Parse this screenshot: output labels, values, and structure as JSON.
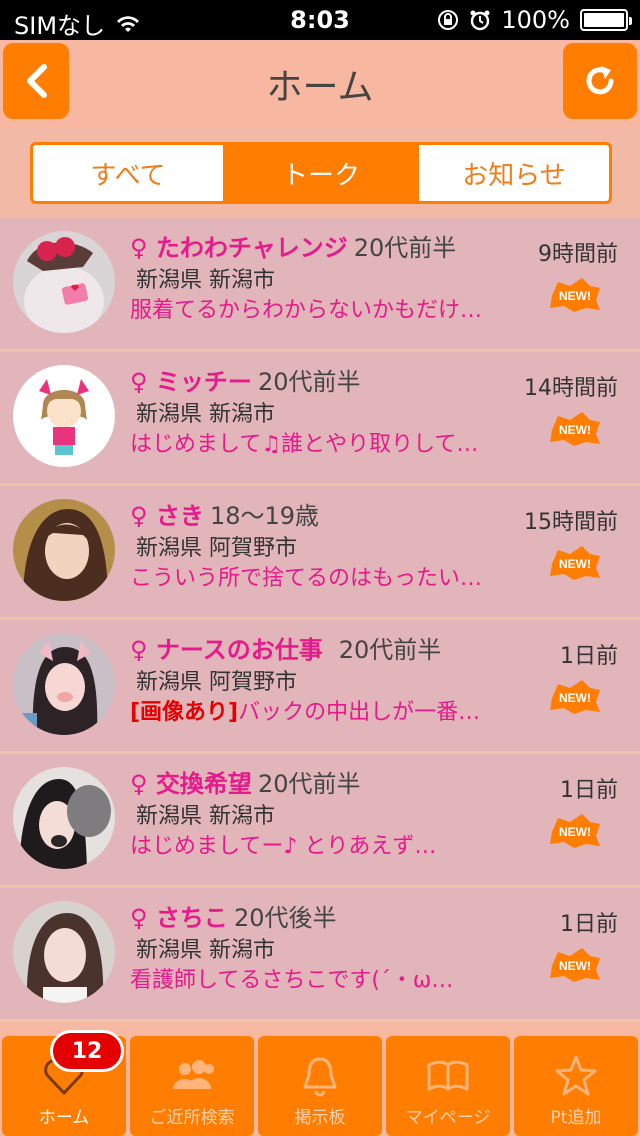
{
  "status_bar": {
    "carrier": "SIMなし",
    "time": "8:03",
    "battery": "100%"
  },
  "header": {
    "title": "ホーム"
  },
  "segments": [
    {
      "label": "すべて",
      "active": false
    },
    {
      "label": "トーク",
      "active": true
    },
    {
      "label": "お知らせ",
      "active": false
    }
  ],
  "items": [
    {
      "name": "♀ たわわチャレンジ",
      "age": "20代前半",
      "location": "新潟県 新潟市",
      "message": "服着てるからわからないかもだけ…",
      "tag": "",
      "time": "9時間前",
      "new": true
    },
    {
      "name": "♀ ミッチー",
      "age": "20代前半",
      "location": "新潟県 新潟市",
      "message": "はじめまして♫誰とやり取りして…",
      "tag": "",
      "time": "14時間前",
      "new": true
    },
    {
      "name": "♀ さき",
      "age": "18〜19歳",
      "location": "新潟県 阿賀野市",
      "message": "こういう所で捨てるのはもったい…",
      "tag": "",
      "time": "15時間前",
      "new": true
    },
    {
      "name": "♀ ナースのお仕事",
      "age": "20代前半",
      "location": "新潟県 阿賀野市",
      "message": "バックの中出しが一番…",
      "tag": "[画像あり]",
      "time": "1日前",
      "new": true
    },
    {
      "name": "♀ 交換希望",
      "age": "20代前半",
      "location": "新潟県 新潟市",
      "message": "はじめましてー♪ とりあえず…",
      "tag": "",
      "time": "1日前",
      "new": true
    },
    {
      "name": "♀ さちこ",
      "age": "20代後半",
      "location": "新潟県 新潟市",
      "message": "看護師してるさちこです(´・ω…",
      "tag": "",
      "time": "1日前",
      "new": true
    }
  ],
  "new_badge_label": "NEW!",
  "tabs": [
    {
      "label": "ホーム",
      "icon": "heart-icon",
      "badge": "12",
      "active": true
    },
    {
      "label": "ご近所検索",
      "icon": "people-icon",
      "active": false
    },
    {
      "label": "掲示板",
      "icon": "bell-icon",
      "active": false
    },
    {
      "label": "マイページ",
      "icon": "book-icon",
      "active": false
    },
    {
      "label": "Pt追加",
      "icon": "star-icon",
      "active": false
    }
  ],
  "colors": {
    "accent": "#ff7d00",
    "name_pink": "#e6198d",
    "row_bg": "#e1b5b9",
    "header_bg": "#f8b7a0",
    "badge_red": "#e40000"
  }
}
